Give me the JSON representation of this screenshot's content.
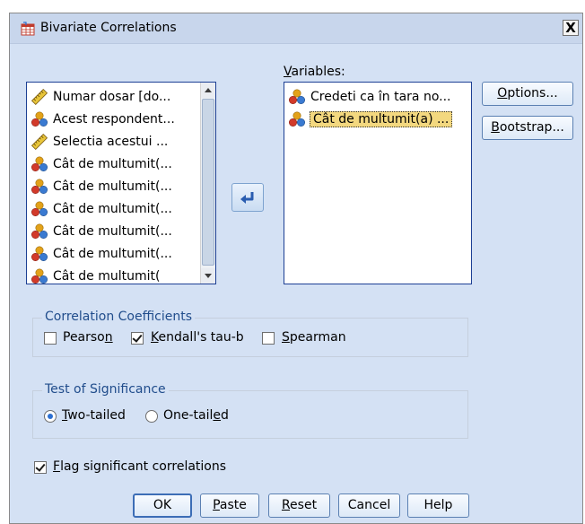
{
  "window": {
    "title": "Bivariate Correlations",
    "close_glyph": "X"
  },
  "source_list": {
    "items": [
      {
        "label": "Numar dosar [do...",
        "icon": "ruler-icon"
      },
      {
        "label": "Acest respondent...",
        "icon": "nominal-icon"
      },
      {
        "label": "Selectia acestui ...",
        "icon": "ruler-icon"
      },
      {
        "label": "Cât de multumit(...",
        "icon": "nominal-icon"
      },
      {
        "label": "Cât de multumit(...",
        "icon": "nominal-icon"
      },
      {
        "label": "Cât de multumit(...",
        "icon": "nominal-icon"
      },
      {
        "label": "Cât de multumit(...",
        "icon": "nominal-icon"
      },
      {
        "label": "Cât de multumit(...",
        "icon": "nominal-icon"
      },
      {
        "label": "Cât de multumit(",
        "icon": "nominal-icon"
      }
    ]
  },
  "variables": {
    "label": "Variables:",
    "items": [
      {
        "label": "Credeti ca în tara no...",
        "icon": "nominal-icon",
        "selected": false
      },
      {
        "label": "Cât de multumit(a) ...",
        "icon": "nominal-icon",
        "selected": true
      }
    ]
  },
  "side_buttons": {
    "options": "Options...",
    "bootstrap": "Bootstrap..."
  },
  "correlation_coefficients": {
    "title": "Correlation Coefficients",
    "pearson": {
      "label": "Pearson",
      "checked": false
    },
    "kendall": {
      "label": "Kendall's tau-b",
      "checked": true
    },
    "spearman": {
      "label": "Spearman",
      "checked": false
    }
  },
  "test_of_significance": {
    "title": "Test of Significance",
    "two_tailed": {
      "label": "Two-tailed",
      "selected": true
    },
    "one_tailed": {
      "label": "One-tailed",
      "selected": false
    }
  },
  "flag": {
    "label": "Flag significant correlations",
    "checked": true
  },
  "buttons": {
    "ok": "OK",
    "paste": "Paste",
    "reset": "Reset",
    "cancel": "Cancel",
    "help": "Help"
  },
  "colors": {
    "title_bar": "#c8d6ec",
    "dialog_bg": "#d4e1f4",
    "list_border": "#1c3f94",
    "group_title": "#214d8c",
    "selection": "#f3d87f"
  }
}
